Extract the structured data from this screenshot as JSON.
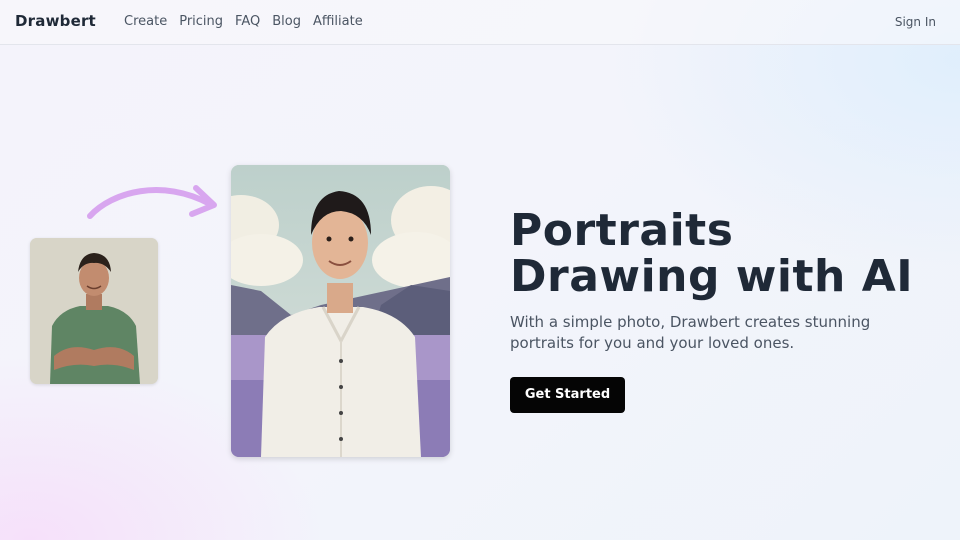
{
  "nav": {
    "logo": "Drawbert",
    "links": [
      "Create",
      "Pricing",
      "FAQ",
      "Blog",
      "Affiliate"
    ],
    "sign_in": "Sign In"
  },
  "hero": {
    "headline_line1": "Portraits",
    "headline_line2": "Drawing with AI",
    "subtitle": "With a simple photo, Drawbert creates stunning portraits for you and your loved ones.",
    "cta": "Get Started"
  },
  "colors": {
    "arrow": "#d8a6ef",
    "cta_bg": "#050505",
    "text_primary": "#1f2937",
    "text_secondary": "#4b5563"
  },
  "icons": {
    "arrow": "curved-arrow-icon"
  }
}
